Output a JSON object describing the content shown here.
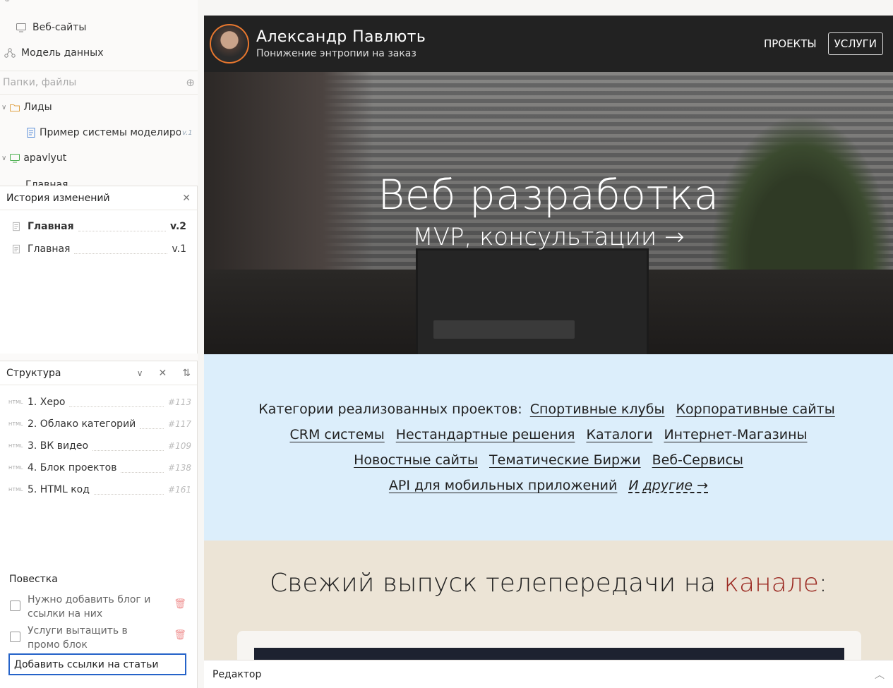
{
  "sidebar": {
    "websites_label": "Веб-сайты",
    "data_model_label": "Модель данных",
    "folders_placeholder": "Папки, файлы",
    "tree": {
      "leads_label": "Лиды",
      "doc_label": "Пример системы моделирования",
      "doc_version": "v.1",
      "site_label": "apavlyut",
      "partial_label": "Главная"
    }
  },
  "history": {
    "title": "История изменений",
    "items": [
      {
        "label": "Главная",
        "version": "v.2"
      },
      {
        "label": "Главная",
        "version": "v.1"
      }
    ]
  },
  "structure": {
    "title": "Структура",
    "tag": "HTML",
    "items": [
      {
        "label": "1. Херо",
        "id": "#113"
      },
      {
        "label": "2. Облако категорий",
        "id": "#117"
      },
      {
        "label": "3. ВК видео",
        "id": "#109"
      },
      {
        "label": "4. Блок проектов",
        "id": "#138"
      },
      {
        "label": "5. HTML код",
        "id": "#161"
      }
    ]
  },
  "agenda": {
    "title": "Повестка",
    "items": [
      {
        "text": "Нужно добавить блог и ссылки на них"
      },
      {
        "text": "Услуги вытащить в промо блок"
      }
    ],
    "input_value": "Добавить ссылки на статьи"
  },
  "site": {
    "name": "Александр Павлють",
    "tagline": "Понижение энтропии на заказ",
    "nav": [
      "ПРОЕКТЫ",
      "УСЛУГИ"
    ],
    "hero_title": "Веб разработка",
    "hero_sub": "MVP, консультации →",
    "cats_prefix": "Категории реализованных проектов:",
    "categories": [
      "Спортивные клубы",
      "Корпоративные сайты",
      "CRM системы",
      "Нестандартные решения",
      "Каталоги",
      "Интернет-Магазины",
      "Новостные сайты",
      "Тематические Биржи",
      "Веб-Сервисы",
      "API для мобильных приложений"
    ],
    "others": "И другие →",
    "tv_title": "Свежий выпуск телепередачи на",
    "tv_highlight": "канале",
    "tv_colon": ":"
  },
  "editor": {
    "label": "Редактор"
  }
}
